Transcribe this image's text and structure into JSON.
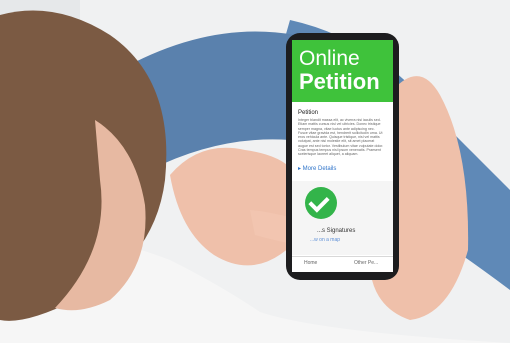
{
  "screen": {
    "hero_line1": "Online",
    "hero_line2": "Petition",
    "petition_title": "Petition",
    "petition_body": "Integer blandit massa elit, ac viverra nisi iaculis sed. Etiam mattis cursus nisl vel ultricies. Donec tristique semper magna, vitae luctus ante adipiscing nec. Fusce vitae gravida est, hendrerit sollicitudin urna. Ut eros vehicula ante. Quisque tristique, nisl vel mattis volutpat, ante nisl molestie elit, sit amet placerat augue est sed tortor. Vestibulum vitae vulputate dolor. Cras tempus tempus nisl ipsum venenatis. Praesent scelerisque laoreet aliquet, a aliquam.",
    "more_details": "▸ More Details",
    "signatures": "...s Signatures",
    "view_map": "...w on a map",
    "nav_home": "Home",
    "nav_other": "Other Pe..."
  },
  "colors": {
    "hero_green": "#3fc23b",
    "check_green": "#33b44a",
    "link_blue": "#2f74c9"
  }
}
